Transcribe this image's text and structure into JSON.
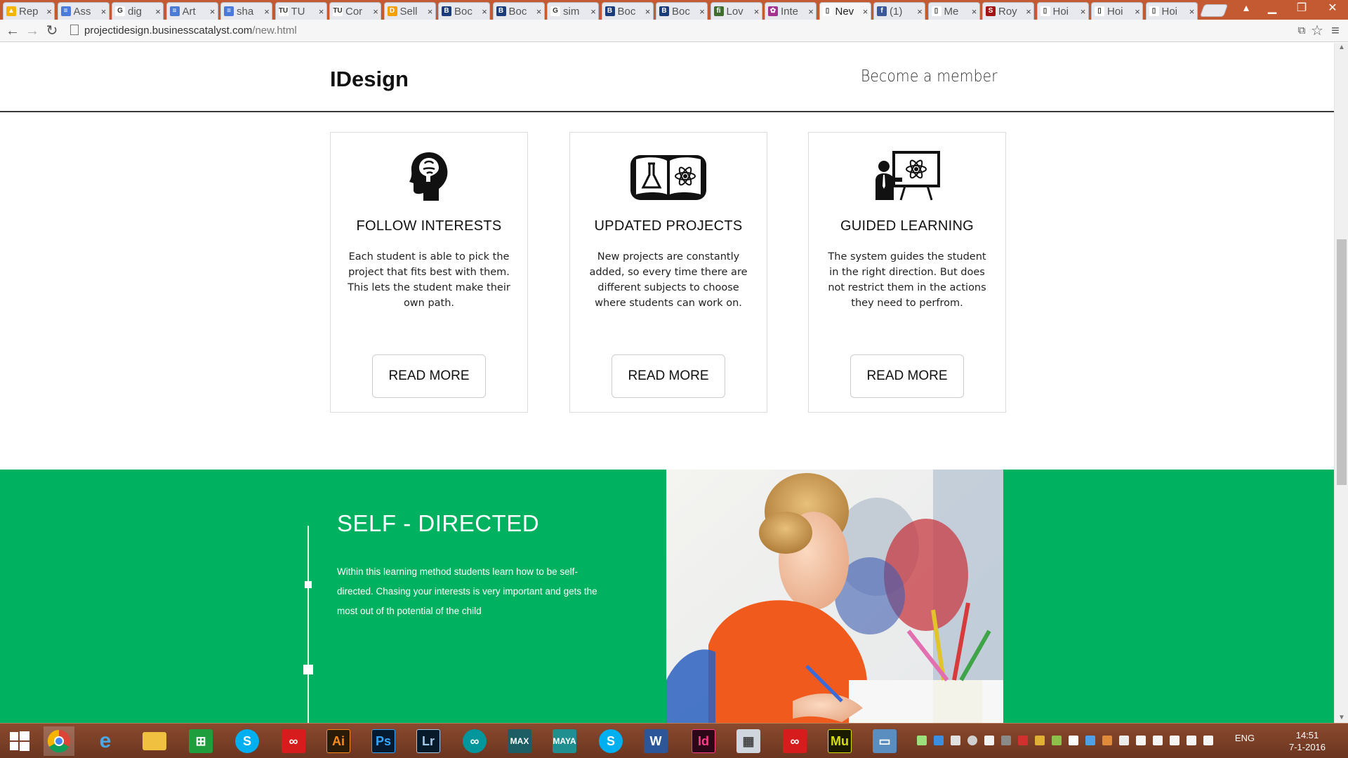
{
  "browser": {
    "tabs": [
      {
        "label": "Rep",
        "fav_color": "#f4b400",
        "fav": "▲"
      },
      {
        "label": "Ass",
        "fav_color": "#4a7bd6",
        "fav": "≡"
      },
      {
        "label": "dig",
        "fav_color": "#ffffff",
        "fav": "G"
      },
      {
        "label": "Art",
        "fav_color": "#4a7bd6",
        "fav": "≡"
      },
      {
        "label": "sha",
        "fav_color": "#4a7bd6",
        "fav": "≡"
      },
      {
        "label": "TU",
        "fav_color": "#ffffff",
        "fav": "TU"
      },
      {
        "label": "Cor",
        "fav_color": "#ffffff",
        "fav": "TU"
      },
      {
        "label": "Sell",
        "fav_color": "#f2a100",
        "fav": "D"
      },
      {
        "label": "Boc",
        "fav_color": "#1a3c7a",
        "fav": "B"
      },
      {
        "label": "Boc",
        "fav_color": "#1a3c7a",
        "fav": "B"
      },
      {
        "label": "sim",
        "fav_color": "#ffffff",
        "fav": "G"
      },
      {
        "label": "Boc",
        "fav_color": "#1a3c7a",
        "fav": "B"
      },
      {
        "label": "Boc",
        "fav_color": "#1a3c7a",
        "fav": "B"
      },
      {
        "label": "Lov",
        "fav_color": "#3f6e2f",
        "fav": "fi"
      },
      {
        "label": "Inte",
        "fav_color": "#a3338f",
        "fav": "✿"
      },
      {
        "label": "Nev",
        "fav_color": "#ffffff",
        "fav": "▯"
      },
      {
        "label": "(1)",
        "fav_color": "#3b5998",
        "fav": "f"
      },
      {
        "label": "Me",
        "fav_color": "#ffffff",
        "fav": "▯"
      },
      {
        "label": "Roy",
        "fav_color": "#a31515",
        "fav": "S"
      },
      {
        "label": "Hoi",
        "fav_color": "#ffffff",
        "fav": "▯"
      },
      {
        "label": "Hoi",
        "fav_color": "#ffffff",
        "fav": "▯"
      },
      {
        "label": "Hoi",
        "fav_color": "#ffffff",
        "fav": "▯"
      }
    ],
    "tab_close": "×",
    "active_tab_index": 15,
    "url_host": "projectidesign.businesscatalyst.com",
    "url_path": "/new.html"
  },
  "site": {
    "brand": "IDesign",
    "member_link": "Become a member",
    "cards": [
      {
        "icon": "head-icon",
        "title": "FOLLOW INTERESTS",
        "text": "Each student is able to pick the project that fits best with them. This lets the student make their own path.",
        "button": "READ MORE"
      },
      {
        "icon": "science-book-icon",
        "title": "UPDATED PROJECTS",
        "text": "New projects are constantly added, so every time there are different subjects to choose where students can work on.",
        "button": "READ MORE"
      },
      {
        "icon": "teacher-board-icon",
        "title": "GUIDED LEARNING",
        "text": "The system guides the student in the right direction. But does not restrict them in the actions they need to perfrom.",
        "button": "READ MORE"
      }
    ],
    "feature": {
      "title": "SELF - DIRECTED",
      "text": "Within this learning method students learn how to be self-directed. Chasing your interests is very important and gets the most out of th potential of the child",
      "image": "child-drawing-photo"
    },
    "colors": {
      "green": "#00b15f",
      "text": "#111111"
    }
  },
  "taskbar": {
    "apps": [
      "windows-start-icon",
      "chrome-icon",
      "internet-explorer-icon",
      "file-explorer-icon",
      "store-icon",
      "skype-icon",
      "creative-cloud-icon",
      "illustrator-icon",
      "photoshop-icon",
      "lightroom-icon",
      "arduino-icon",
      "3dsmax-icon",
      "maya-icon",
      "skype-icon",
      "word-icon",
      "indesign-icon",
      "calculator-icon",
      "creative-cloud-icon",
      "muse-icon",
      "photos-icon"
    ],
    "app_labels": {
      "illustrator": "Ai",
      "photoshop": "Ps",
      "lightroom": "Lr",
      "word": "W",
      "indesign": "Id",
      "muse": "Mu"
    },
    "language": "ENG",
    "time": "14:51",
    "date": "7-1-2016"
  }
}
